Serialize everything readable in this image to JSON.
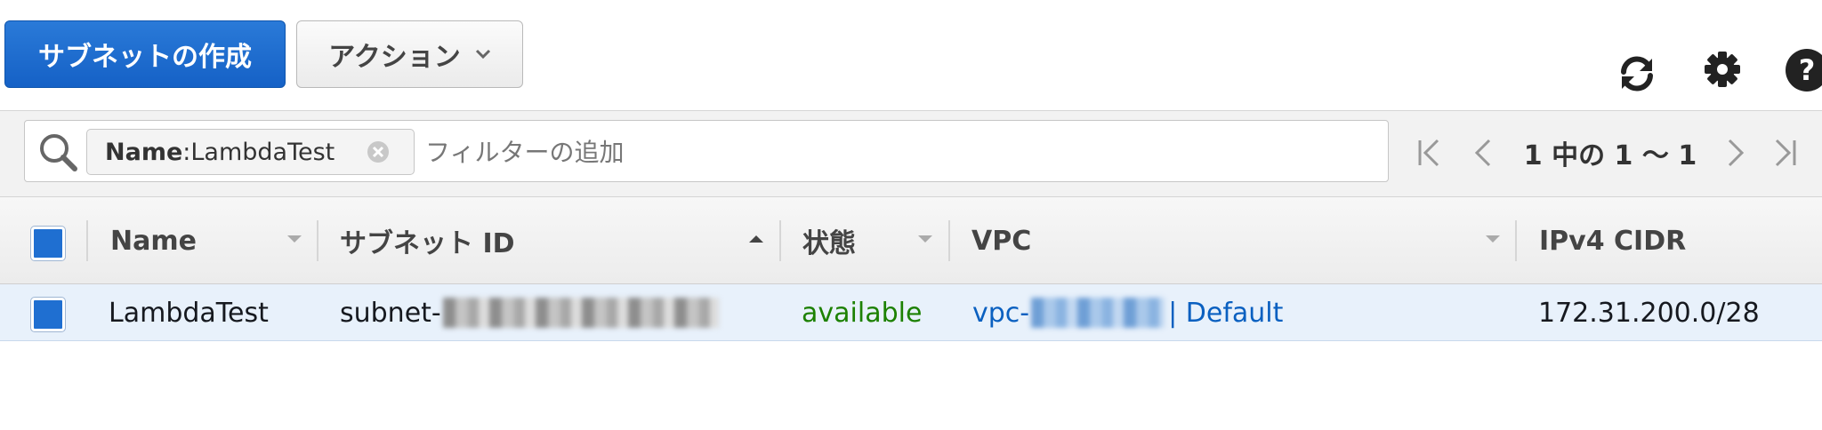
{
  "toolbar": {
    "create_label": "サブネットの作成",
    "actions_label": "アクション"
  },
  "icons": {
    "refresh": "refresh-icon",
    "settings": "gear-icon",
    "help": "help-icon",
    "search": "search-icon",
    "clear": "clear-icon",
    "first": "first-page-icon",
    "prev": "prev-page-icon",
    "next": "next-page-icon",
    "last": "last-page-icon",
    "sort_down": "caret-down-icon",
    "sort_up": "caret-up-icon"
  },
  "filter": {
    "token_key": "Name",
    "token_sep": " : ",
    "token_value": "LambdaTest",
    "placeholder": "フィルターの追加"
  },
  "pager": {
    "text": "1 中の 1 ～ 1"
  },
  "table": {
    "columns": [
      "Name",
      "サブネット ID",
      "状態",
      "VPC",
      "IPv4 CIDR"
    ],
    "rows": [
      {
        "name": "LambdaTest",
        "subnet_prefix": "subnet-",
        "state": "available",
        "vpc_prefix": "vpc-",
        "vpc_suffix": "| Default",
        "cidr": "172.31.200.0/28",
        "selected": true
      }
    ]
  },
  "colors": {
    "primary": "#1a6ad0",
    "state_available": "#1d8102",
    "link": "#0a60c0",
    "row_selected": "#e8f1fb"
  }
}
